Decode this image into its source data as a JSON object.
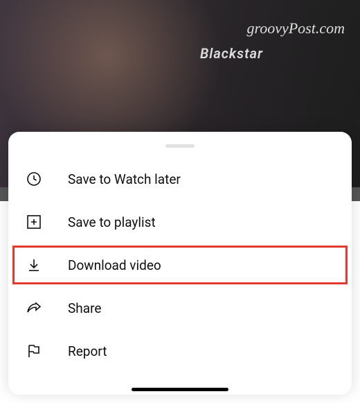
{
  "watermark": "groovyPost.com",
  "ampLabel": "Blackstar",
  "menu": {
    "items": [
      {
        "label": "Save to Watch later",
        "icon": "clock-icon"
      },
      {
        "label": "Save to playlist",
        "icon": "playlist-add-icon"
      },
      {
        "label": "Download video",
        "icon": "download-icon",
        "highlighted": true
      },
      {
        "label": "Share",
        "icon": "share-icon"
      },
      {
        "label": "Report",
        "icon": "flag-icon"
      }
    ]
  }
}
